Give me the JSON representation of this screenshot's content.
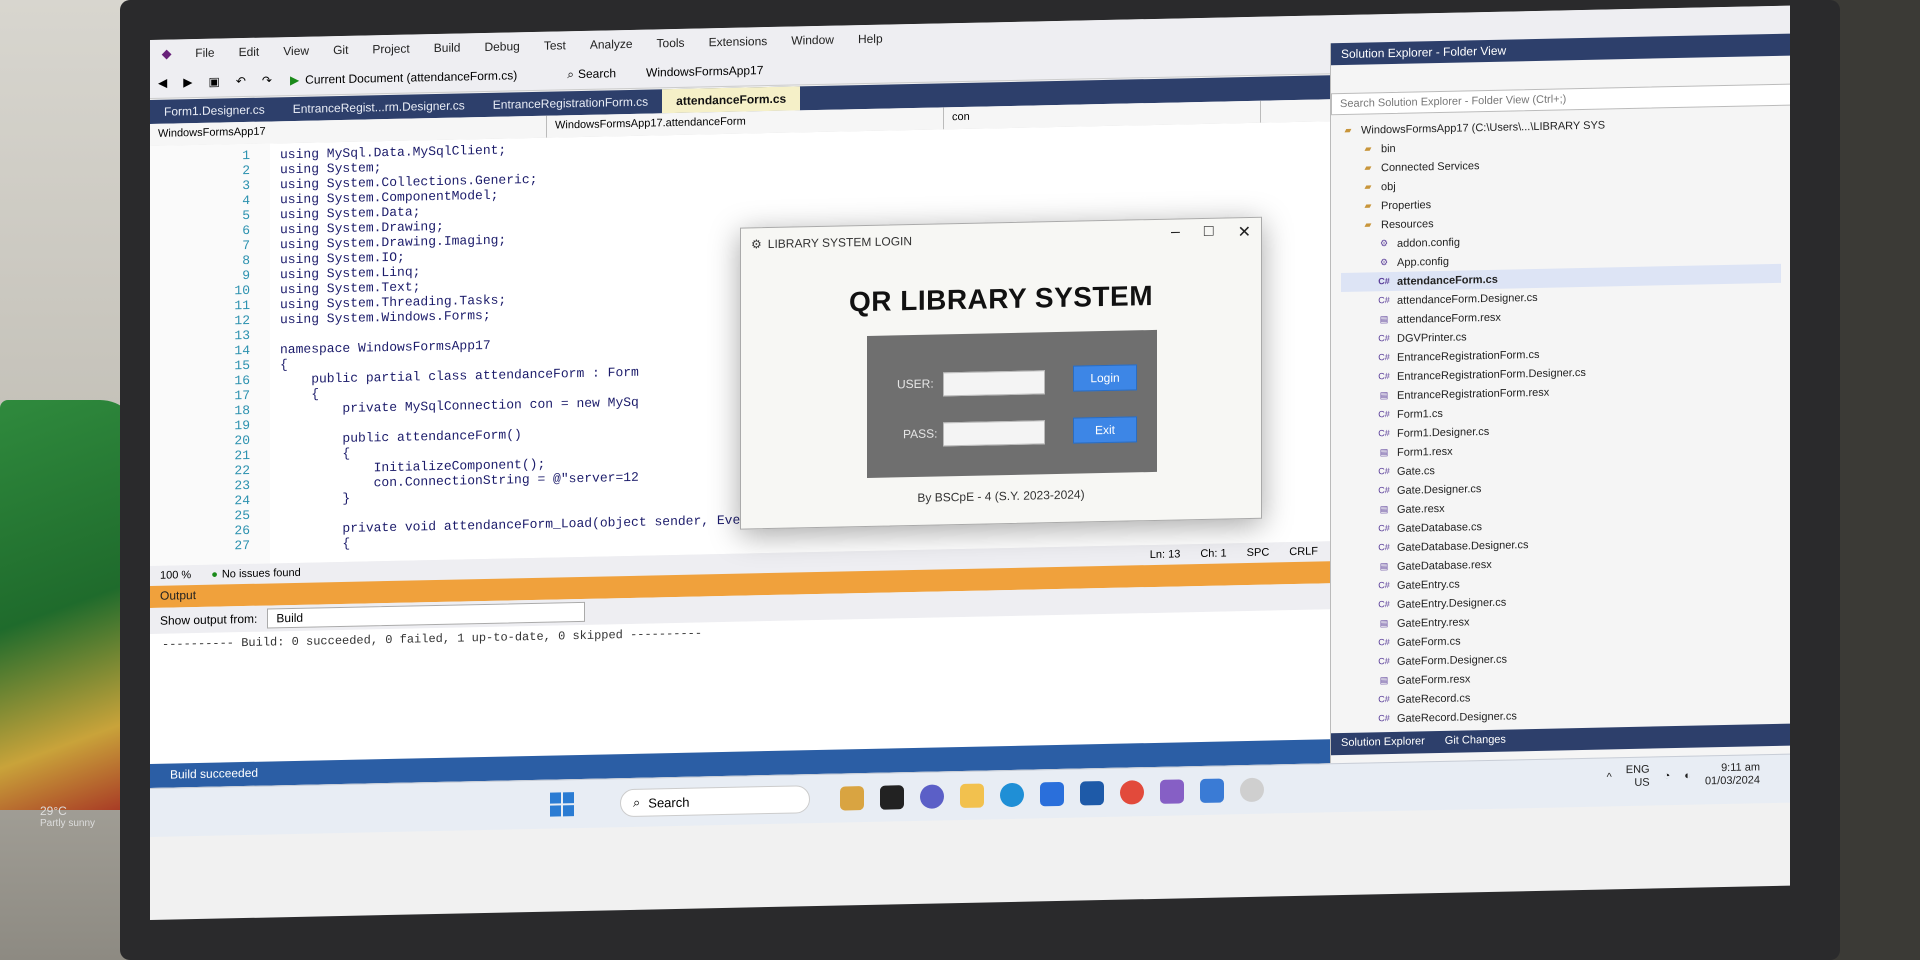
{
  "menu": [
    "File",
    "Edit",
    "View",
    "Git",
    "Project",
    "Build",
    "Debug",
    "Test",
    "Analyze",
    "Tools",
    "Extensions",
    "Window",
    "Help"
  ],
  "search_label": "Search",
  "solution_name": "WindowsFormsApp17",
  "toolbar": {
    "run_label": "Current Document (attendanceForm.cs)"
  },
  "doc_tabs": [
    "Form1.Designer.cs",
    "EntranceRegist...rm.Designer.cs",
    "EntranceRegistrationForm.cs",
    "attendanceForm.cs"
  ],
  "navbar": {
    "project": "WindowsFormsApp17",
    "class": "WindowsFormsApp17.attendanceForm",
    "member": "con"
  },
  "code_lines": [
    {
      "n": "1",
      "t": "using MySql.Data.MySqlClient;"
    },
    {
      "n": "2",
      "t": "using System;"
    },
    {
      "n": "3",
      "t": "using System.Collections.Generic;"
    },
    {
      "n": "4",
      "t": "using System.ComponentModel;"
    },
    {
      "n": "5",
      "t": "using System.Data;"
    },
    {
      "n": "6",
      "t": "using System.Drawing;"
    },
    {
      "n": "7",
      "t": "using System.Drawing.Imaging;"
    },
    {
      "n": "8",
      "t": "using System.IO;"
    },
    {
      "n": "9",
      "t": "using System.Linq;"
    },
    {
      "n": "10",
      "t": "using System.Text;"
    },
    {
      "n": "11",
      "t": "using System.Threading.Tasks;"
    },
    {
      "n": "12",
      "t": "using System.Windows.Forms;"
    },
    {
      "n": "13",
      "t": ""
    },
    {
      "n": "14",
      "t": "namespace WindowsFormsApp17"
    },
    {
      "n": "15",
      "t": "{"
    },
    {
      "n": "16",
      "t": "    public partial class attendanceForm : Form"
    },
    {
      "n": "17",
      "t": "    {"
    },
    {
      "n": "18",
      "t": "        private MySqlConnection con = new MySq"
    },
    {
      "n": "19",
      "t": ""
    },
    {
      "n": "20",
      "t": "        public attendanceForm()"
    },
    {
      "n": "21",
      "t": "        {"
    },
    {
      "n": "22",
      "t": "            InitializeComponent();"
    },
    {
      "n": "23",
      "t": "            con.ConnectionString = @\"server=12"
    },
    {
      "n": "24",
      "t": "        }"
    },
    {
      "n": "25",
      "t": ""
    },
    {
      "n": "26",
      "t": "        private void attendanceForm_Load(object sender, EventArgs e)"
    },
    {
      "n": "27",
      "t": "        {"
    }
  ],
  "editor_status": {
    "zoom": "100 %",
    "issues": "No issues found",
    "ln": "Ln: 13",
    "ch": "Ch: 1",
    "spc": "SPC",
    "crlf": "CRLF"
  },
  "output": {
    "title": "Output",
    "show_from_label": "Show output from:",
    "source": "Build",
    "text": "---------- Build: 0 succeeded, 0 failed, 1 up-to-date, 0 skipped ----------"
  },
  "statusbar_text": "Build succeeded",
  "solution_explorer": {
    "title": "Solution Explorer - Folder View",
    "search_placeholder": "Search Solution Explorer - Folder View (Ctrl+;)",
    "items": [
      {
        "icon": "folder-icon",
        "label": "WindowsFormsApp17 (C:\\Users\\...\\LIBRARY SYS"
      },
      {
        "icon": "folder-icon",
        "label": "bin"
      },
      {
        "icon": "folder-icon",
        "label": "Connected Services"
      },
      {
        "icon": "folder-icon",
        "label": "obj"
      },
      {
        "icon": "folder-icon",
        "label": "Properties"
      },
      {
        "icon": "folder-icon",
        "label": "Resources"
      },
      {
        "icon": "config-icon",
        "label": "addon.config"
      },
      {
        "icon": "config-icon",
        "label": "App.config"
      },
      {
        "icon": "cs-file-icon",
        "label": "attendanceForm.cs"
      },
      {
        "icon": "cs-file-icon",
        "label": "attendanceForm.Designer.cs"
      },
      {
        "icon": "resx-file-icon",
        "label": "attendanceForm.resx"
      },
      {
        "icon": "cs-file-icon",
        "label": "DGVPrinter.cs"
      },
      {
        "icon": "cs-file-icon",
        "label": "EntranceRegistrationForm.cs"
      },
      {
        "icon": "cs-file-icon",
        "label": "EntranceRegistrationForm.Designer.cs"
      },
      {
        "icon": "resx-file-icon",
        "label": "EntranceRegistrationForm.resx"
      },
      {
        "icon": "cs-file-icon",
        "label": "Form1.cs"
      },
      {
        "icon": "cs-file-icon",
        "label": "Form1.Designer.cs"
      },
      {
        "icon": "resx-file-icon",
        "label": "Form1.resx"
      },
      {
        "icon": "cs-file-icon",
        "label": "Gate.cs"
      },
      {
        "icon": "cs-file-icon",
        "label": "Gate.Designer.cs"
      },
      {
        "icon": "resx-file-icon",
        "label": "Gate.resx"
      },
      {
        "icon": "cs-file-icon",
        "label": "GateDatabase.cs"
      },
      {
        "icon": "cs-file-icon",
        "label": "GateDatabase.Designer.cs"
      },
      {
        "icon": "resx-file-icon",
        "label": "GateDatabase.resx"
      },
      {
        "icon": "cs-file-icon",
        "label": "GateEntry.cs"
      },
      {
        "icon": "cs-file-icon",
        "label": "GateEntry.Designer.cs"
      },
      {
        "icon": "resx-file-icon",
        "label": "GateEntry.resx"
      },
      {
        "icon": "cs-file-icon",
        "label": "GateForm.cs"
      },
      {
        "icon": "cs-file-icon",
        "label": "GateForm.Designer.cs"
      },
      {
        "icon": "resx-file-icon",
        "label": "GateForm.resx"
      },
      {
        "icon": "cs-file-icon",
        "label": "GateRecord.cs"
      },
      {
        "icon": "cs-file-icon",
        "label": "GateRecord.Designer.cs"
      }
    ],
    "tabs": [
      "Solution Explorer",
      "Git Changes"
    ]
  },
  "login_dialog": {
    "window_title": "LIBRARY SYSTEM LOGIN",
    "heading": "QR LIBRARY SYSTEM",
    "user_label": "USER:",
    "pass_label": "PASS:",
    "login_button": "Login",
    "exit_button": "Exit",
    "footer": "By BSCpE - 4 (S.Y. 2023-2024)"
  },
  "taskbar": {
    "search": "Search",
    "lang": "ENG",
    "region": "US",
    "time": "9:11 am",
    "date": "01/03/2024"
  },
  "weather": {
    "temp": "29°C",
    "desc": "Partly sunny"
  },
  "colors": {
    "tab_bar": "#2d3f6b",
    "output_accent": "#f0a13c",
    "status_bar": "#2b5ea5",
    "button_blue": "#3d86e6"
  }
}
